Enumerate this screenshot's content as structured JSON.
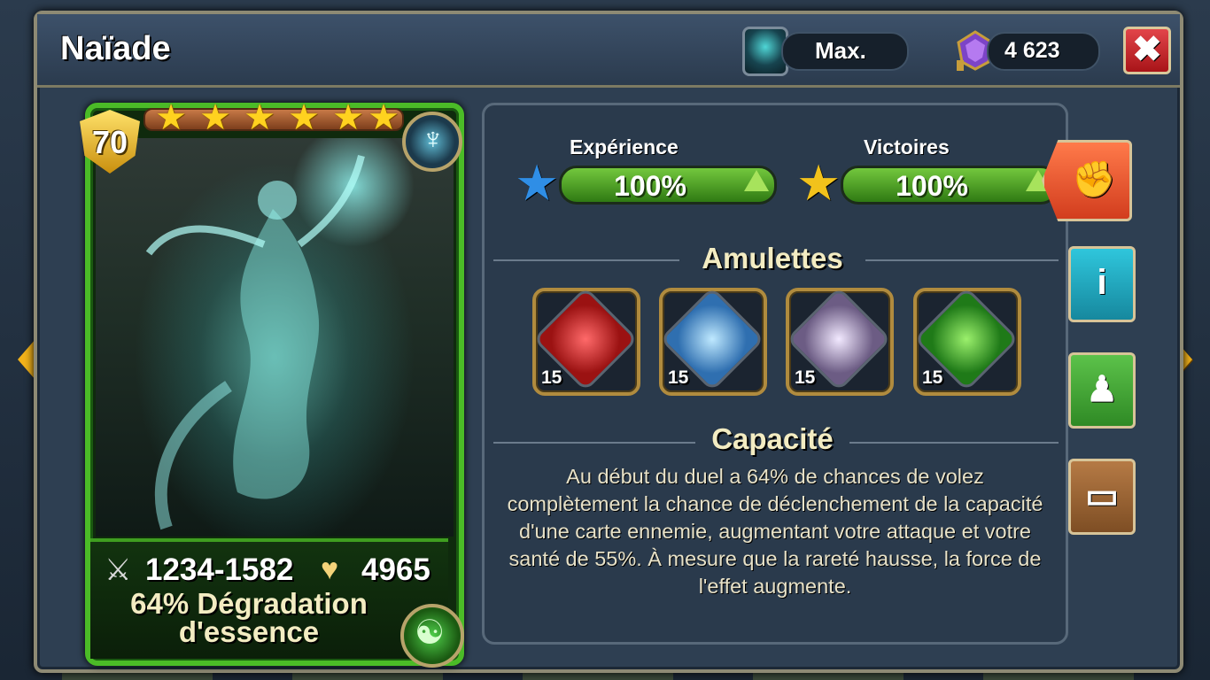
{
  "header": {
    "title": "Naïade",
    "essence_label": "Max.",
    "gems_value": "4 623",
    "close_label": "✖"
  },
  "card": {
    "level": "70",
    "stars": 6,
    "attack": "1234-1582",
    "health": "4965",
    "ability_short": "64% Dégradation d'essence"
  },
  "progress": {
    "experience": {
      "label": "Expérience",
      "value": "100%"
    },
    "victories": {
      "label": "Victoires",
      "value": "100%"
    }
  },
  "amulets": {
    "heading": "Amulettes",
    "items": [
      {
        "level": "15",
        "color": "#c02525"
      },
      {
        "level": "15",
        "color": "#4aa7d8"
      },
      {
        "level": "15",
        "color": "#b7a6c8"
      },
      {
        "level": "15",
        "color": "#3fae2a"
      }
    ]
  },
  "ability": {
    "heading": "Capacité",
    "text": "Au début du duel a 64% de chances de volez complètement la chance de déclenchement de la capacité d'une carte ennemie, augmentant votre attaque et votre santé de 55%. À mesure que la rareté hausse, la force de l'effet augmente."
  },
  "side_buttons": [
    {
      "icon": "fist-icon",
      "color": "#e6532e"
    },
    {
      "icon": "info-icon",
      "color": "#1fb0c8"
    },
    {
      "icon": "person-icon",
      "color": "#3fa33b"
    },
    {
      "icon": "book-icon",
      "color": "#9a6a3a"
    }
  ]
}
